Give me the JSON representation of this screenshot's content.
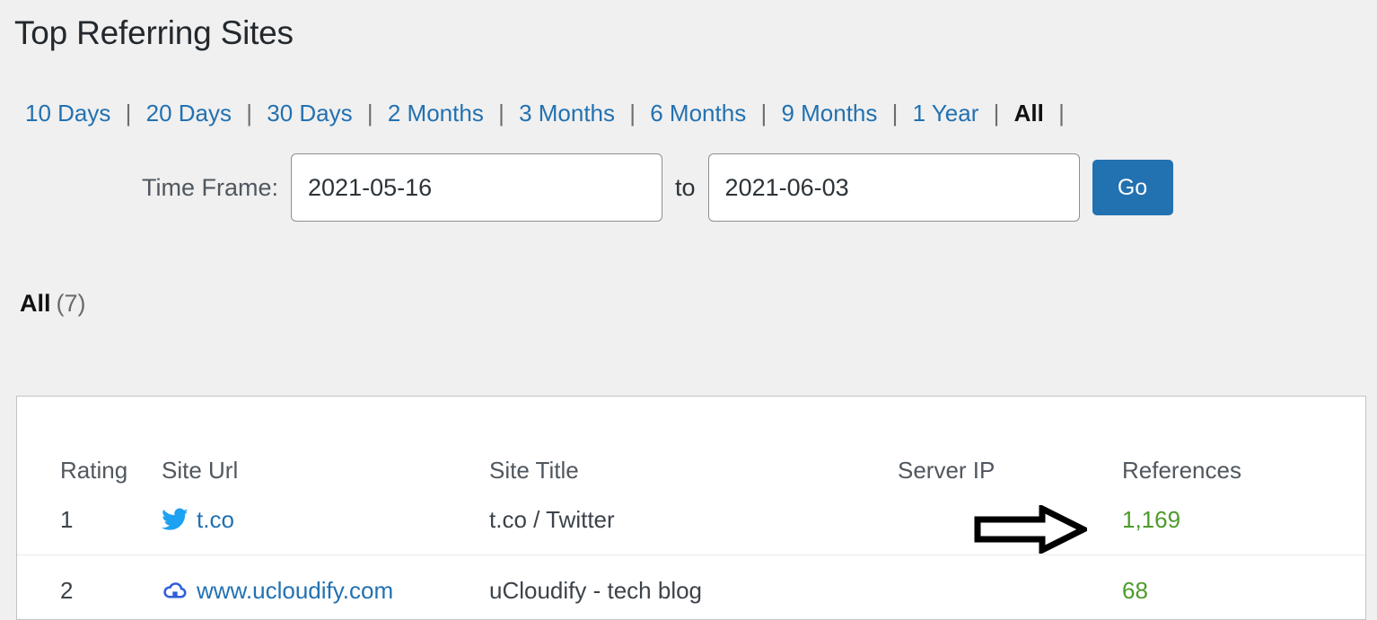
{
  "page": {
    "title": "Top Referring Sites"
  },
  "range_nav": {
    "separator": "|",
    "leading_separator": false,
    "trailing_separator": "|",
    "items": [
      {
        "label": "10 Days",
        "active": false
      },
      {
        "label": "20 Days",
        "active": false
      },
      {
        "label": "30 Days",
        "active": false
      },
      {
        "label": "2 Months",
        "active": false
      },
      {
        "label": "3 Months",
        "active": false
      },
      {
        "label": "6 Months",
        "active": false
      },
      {
        "label": "9 Months",
        "active": false
      },
      {
        "label": "1 Year",
        "active": false
      },
      {
        "label": "All",
        "active": true
      }
    ]
  },
  "timeframe": {
    "label": "Time Frame:",
    "from_value": "2021-05-16",
    "from_placeholder": "YYYY-MM-DD",
    "to_label": "to",
    "to_value": "2021-06-03",
    "to_placeholder": "YYYY-MM-DD",
    "go_label": "Go"
  },
  "summary": {
    "filter_label": "All",
    "count": "(7)"
  },
  "table": {
    "columns": [
      {
        "key": "rating",
        "label": "Rating"
      },
      {
        "key": "site_url",
        "label": "Site Url"
      },
      {
        "key": "site_title",
        "label": "Site Title"
      },
      {
        "key": "server_ip",
        "label": "Server IP"
      },
      {
        "key": "references",
        "label": "References"
      }
    ],
    "rows": [
      {
        "rating": "1",
        "site_url": "t.co",
        "favicon": "twitter-bird-icon",
        "favicon_color": "#1da1f2",
        "site_title": "t.co / Twitter",
        "server_ip": "",
        "references": "1,169"
      },
      {
        "rating": "2",
        "site_url": "www.ucloudify.com",
        "favicon": "cloud-icon",
        "favicon_color": "#2f5fdc",
        "site_title": "uCloudify - tech blog",
        "server_ip": "",
        "references": "68"
      }
    ]
  },
  "annotation": {
    "arrow": "right-arrow-annotation",
    "color": "#000000"
  },
  "colors": {
    "link": "#2271b1",
    "accent_button": "#2271b1",
    "references_green": "#4d9b2b",
    "page_background": "#f0f0f0",
    "card_background": "#ffffff",
    "card_border": "#c3c4c7"
  }
}
